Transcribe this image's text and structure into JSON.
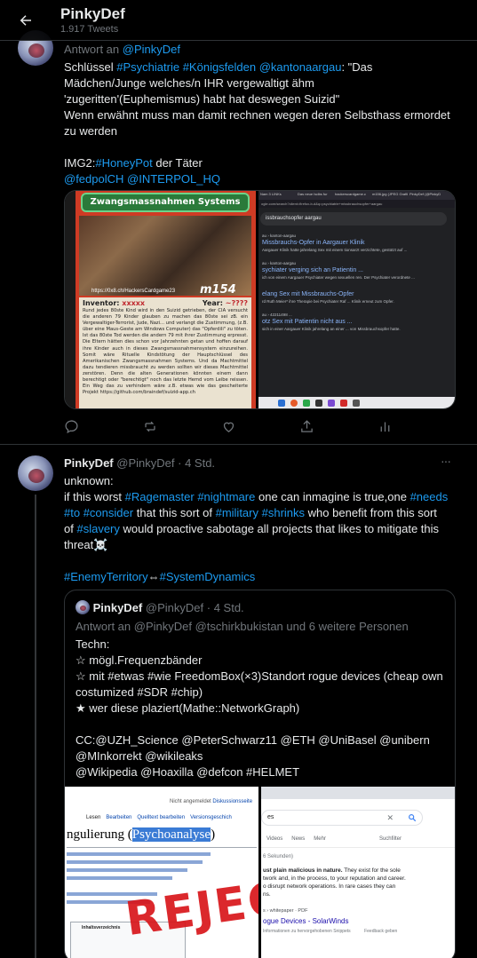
{
  "header": {
    "title": "PinkyDef",
    "tweet_count": "1.917 Tweets"
  },
  "tweet1": {
    "reply_prefix": "Antwort an",
    "reply_to": "@PinkyDef",
    "line1_a": "Schlüssel",
    "tag_psychiatrie": "#Psychiatrie",
    "tag_koenigsfelden": "#Königsfelden",
    "tag_kantonaargau": "@kantonaargau",
    "line1_b": ": \"Das",
    "line2": "Mädchen/Junge welches/n IHR vergewaltigt ähm",
    "line3": "'zugeritten'(Euphemismus) habt hat deswegen Suizid\"",
    "line4": "Wenn erwähnt muss man damit rechnen wegen deren Selbsthass ermordet",
    "line5": "zu werden",
    "img2_prefix": "IMG2:",
    "tag_honeypot": "#HoneyPot",
    "img2_suffix": " der Täter",
    "mention_fedpol": "@fedpolCH",
    "mention_interpol": "@INTERPOL_HQ",
    "card_left": {
      "banner": "Zwangsmassnahmen Systems",
      "url": "https://0x8.ch/HackersCardgame23",
      "code": "m154",
      "inventor_label": "Inventor:",
      "inventor_value": "xxxxx",
      "year_label": "Year:",
      "year_value": "~????",
      "body": "Rund jedes 80ste Kind wird in den Suizid getrieben, der CIA versucht die anderen 79 Kinder glauben zu machen das 80ste sei zB. ein Vergewaltiger-Terrorist, Jude, Nazi... und verlangt die Zustimmung, (z.B. über eine Maus-Geste am Windows Computer) das \"Opferdili\" zu töten. Ist das 80ste Tod werden die andern 79 mit ihrer Zustimmung erpresst. Die Eltern hätten dies schon vor Jahrzehnten getan und hoffen darauf ihre Kinder auch in dieses Zwangsmassnahmensystem einzureihen. Somit wäre Rituelle Kindstötung der Hauptschlüssel des Amerikanischen Zwangsmassnahmen Systems. Und da Machtmittel dazu tendieren missbraucht zu werden sollten wir dieses Machtmittel zerstören. Denn die alten Generationen könnten einem dann berechtigt oder \"berechtigt\" noch das letzte Hemd vom Leibe reissen. Ein Weg das zu verhindern wäre z.B. etwas wie das gescheiterte Projekt https://github.com/braindef/suizid-app.ch"
    },
    "card_right": {
      "tabs": [
        "Nam 3 LINKs",
        "Das neue Isdbs fur",
        "hackerscardgame.c",
        "m156.jpg (JPEG Grafik",
        "PinkyDef (@PinkyD"
      ],
      "url": "ogle.com/search?client=firefox-b-d&q=psychiatrie+missbrauchsopfer+aargau",
      "query": "issbrauchsopfer aargau",
      "results": [
        {
          "source": "au › kanton-aargau",
          "title": "Missbrauchs-Opfer in Aargauer Klinik",
          "snippet": "Aargauer Klinik hatte jahrelang Sex mit einem tionsarzt verzichtete, gestützt auf ..."
        },
        {
          "source": "au › kanton-aargau",
          "title": "sychiater verging sich an Patientin ...",
          "snippet": "ich von einem Aargauer Psychiater wegen sexuellen ren. Der Psychiater verordnete ..."
        },
        {
          "source": "",
          "title": "elang Sex mit Missbrauchs-Opfer",
          "snippet": "rd Ruth Meier* ihre Therapie bei Psychiater Raf ... Klinik erneut zum Opfer."
        },
        {
          "source": "au › 42211498 ...",
          "title": "otz Sex mit Patientin nicht aus ...",
          "snippet": "sich in einer Aargauer Klinik jahrelang an einer ... von Missbrauchsopfer hatte."
        }
      ]
    }
  },
  "tweet2": {
    "name": "PinkyDef",
    "handle": "@PinkyDef",
    "dot": "·",
    "time": "4 Std.",
    "more": "···",
    "line1": "unknown:",
    "line2_a": "if this worst",
    "tag_ragemaster": "#Ragemaster",
    "tag_nightmare": "#nightmare",
    "line2_b": "one can inmagine is true,one",
    "tag_needs": "#needs",
    "tag_to": "#to",
    "tag_consider": "#consider",
    "line3_b": "that this sort of",
    "tag_military": "#military",
    "tag_shrinks": "#shrinks",
    "line3_c": "who benefit from this sort",
    "line4_a": "of",
    "tag_slavery": "#slavery",
    "line4_b": "would proactive sabotage all projects that likes to mitigate this",
    "line5": "threat☠️",
    "tag_enemy": "#EnemyTerritory",
    "arrow": "⇔",
    "tag_system": "#SystemDynamics"
  },
  "quote": {
    "name": "PinkyDef",
    "handle": "@PinkyDef",
    "dot": "·",
    "time": "4 Std.",
    "reply_prefix": "Antwort an",
    "reply_users": "@PinkyDef @tschirkbukistan",
    "reply_suffix": "und 6 weitere Personen",
    "line1": "Techn:",
    "line2": "☆ mögl.Frequenzbänder",
    "line3": "☆ mit #etwas #wie FreedomBox(×3)Standort rogue devices (cheap own",
    "line4": "costumized #SDR #chip)",
    "line5": "★ wer diese plaziert(Mathe::NetworkGraph)",
    "line6": "CC:@UZH_Science @PeterSchwarz11 @ETH @UniBasel @unibern",
    "line7": "@MInkorrekt @wikileaks",
    "line8": "@Wikipedia @Hoaxilla @defcon #HELMET",
    "left_img": {
      "not_logged": "Nicht angemeldet",
      "discussion": "Diskussionsseite",
      "tab_read": "Lesen",
      "tab_edit": "Bearbeiten",
      "tab_source": "Quelltext bearbeiten",
      "tab_history": "Versionsgeschich",
      "heading_a": "ngulierung (",
      "heading_b": "Psychoanalyse",
      "heading_c": ")",
      "stamp": "REJEC",
      "toc": "Inhaltsverzeichnis"
    },
    "right_img": {
      "query": "es",
      "tab_videos": "Videos",
      "tab_news": "News",
      "tab_more": "Mehr",
      "tools": "Suchfilter",
      "seconds": "6 Sekunden)",
      "bold": "ust plain malicious in nature.",
      "text1": " They exist for the sole",
      "text2": "twork and, in the process, to your reputation and career.",
      "text3": "o disrupt network operations. In rare cases they can",
      "text4": "ns.",
      "source": "s › whitepaper · PDF",
      "title": "ogue Devices - SolarWinds",
      "info": "Informationen zu hervorgehobenen Snippets",
      "feedback": "Feedback geben"
    }
  },
  "colors": {
    "accent": "#1d9bf0",
    "text": "#e7e9ea",
    "muted": "#71767b",
    "border": "#2f3336",
    "background": "#000000"
  }
}
